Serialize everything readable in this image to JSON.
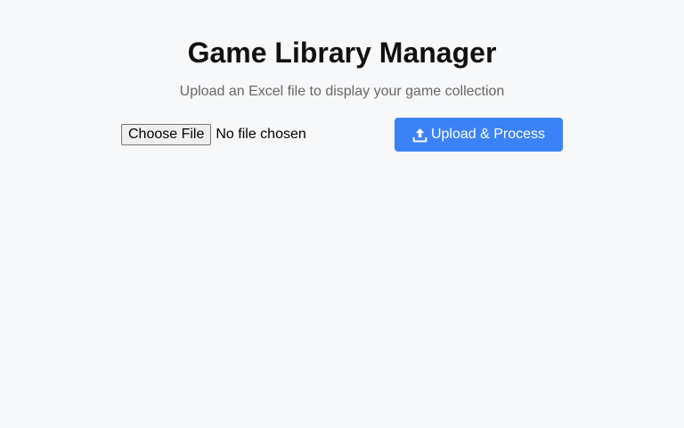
{
  "header": {
    "title": "Game Library Manager",
    "subtitle": "Upload an Excel file to display your game collection"
  },
  "upload": {
    "choose_file_label": "Choose File",
    "file_status": "No file chosen",
    "button_label": "Upload & Process",
    "button_icon": "upload-icon"
  },
  "colors": {
    "background": "#f7f8fa",
    "accent": "#3b82f6",
    "title": "#111111",
    "subtitle": "#666666"
  }
}
